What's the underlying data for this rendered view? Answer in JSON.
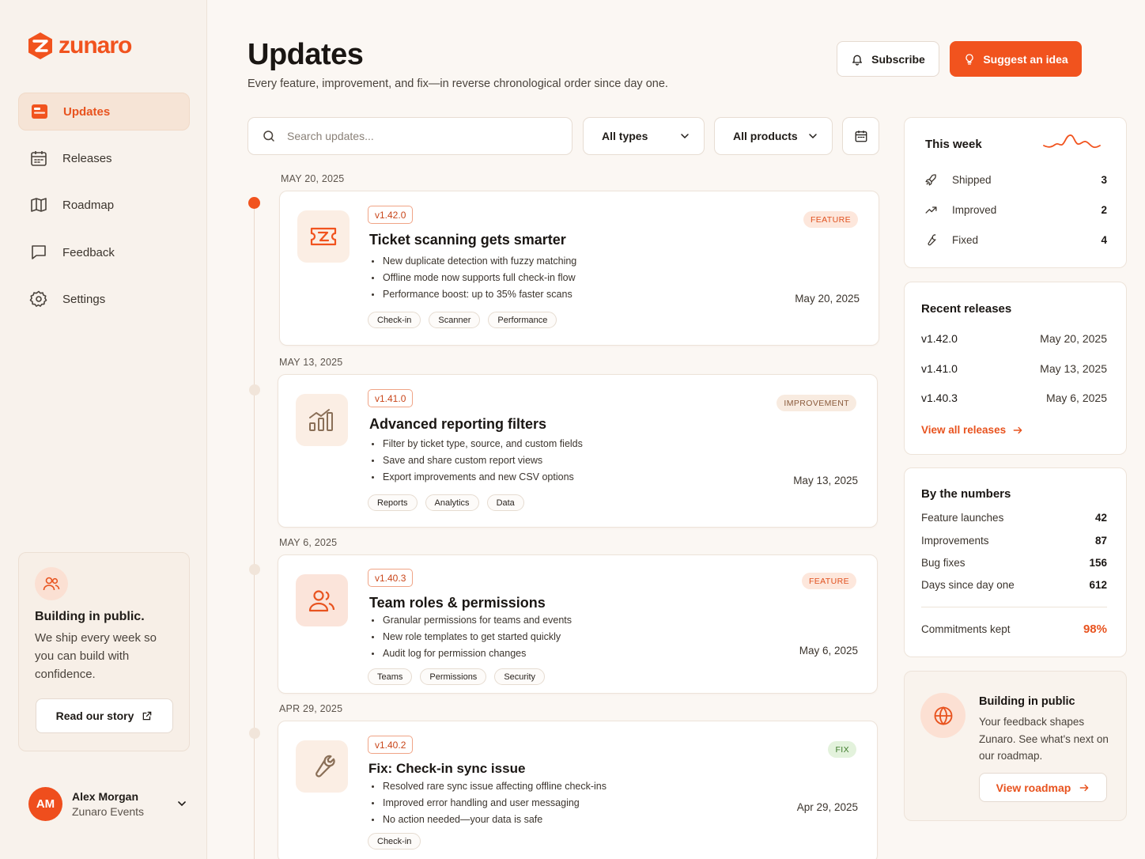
{
  "app": {
    "name": "zunaro"
  },
  "sidebar": {
    "items": [
      {
        "label": "Updates",
        "icon": "updates-icon",
        "active": true
      },
      {
        "label": "Releases",
        "icon": "calendar-icon"
      },
      {
        "label": "Roadmap",
        "icon": "map-icon"
      },
      {
        "label": "Feedback",
        "icon": "chat-bubble-icon"
      },
      {
        "label": "Settings",
        "icon": "gear-icon"
      }
    ],
    "promo": {
      "title": "Building in public.",
      "text": "We ship every week so you can build with confidence.",
      "button": "Read our story"
    },
    "user": {
      "initials": "AM",
      "name": "Alex Morgan",
      "org": "Zunaro Events"
    }
  },
  "header": {
    "title": "Updates",
    "subtitle": "Every feature, improvement, and fix—in reverse chronological order since day one.",
    "subscribe": "Subscribe",
    "suggest": "Suggest an idea"
  },
  "filters": {
    "search_placeholder": "Search updates...",
    "type": "All types",
    "product": "All products"
  },
  "updates": [
    {
      "date_label": "MAY 20, 2025",
      "version": "v1.42.0",
      "title": "Ticket scanning gets smarter",
      "badge": "FEATURE",
      "bullets": [
        "New duplicate detection with fuzzy matching",
        "Offline mode now supports full check-in flow",
        "Performance boost: up to 35% faster scans"
      ],
      "tags": [
        "Check-in",
        "Scanner",
        "Performance"
      ],
      "date": "May 20, 2025"
    },
    {
      "date_label": "MAY 13, 2025",
      "version": "v1.41.0",
      "title": "Advanced reporting filters",
      "badge": "IMPROVEMENT",
      "bullets": [
        "Filter by ticket type, source, and custom fields",
        "Save and share custom report views",
        "Export improvements and new CSV options"
      ],
      "tags": [
        "Reports",
        "Analytics",
        "Data"
      ],
      "date": "May 13, 2025"
    },
    {
      "date_label": "MAY 6, 2025",
      "version": "v1.40.3",
      "title": "Team roles & permissions",
      "badge": "FEATURE",
      "bullets": [
        "Granular permissions for teams and events",
        "New role templates to get started quickly",
        "Audit log for permission changes"
      ],
      "tags": [
        "Teams",
        "Permissions",
        "Security"
      ],
      "date": "May 6, 2025"
    },
    {
      "date_label": "APR 29, 2025",
      "version": "v1.40.2",
      "title": "Fix: Check-in sync issue",
      "badge": "FIX",
      "bullets": [
        "Resolved rare sync issue affecting offline check-ins",
        "Improved error handling and user messaging",
        "No action needed—your data is safe"
      ],
      "tags": [
        "Check-in"
      ],
      "date": "Apr 29, 2025"
    }
  ],
  "this_week": {
    "title": "This week",
    "rows": [
      {
        "label": "Shipped",
        "value": "3"
      },
      {
        "label": "Improved",
        "value": "2"
      },
      {
        "label": "Fixed",
        "value": "4"
      }
    ]
  },
  "recent_releases": {
    "title": "Recent releases",
    "rows": [
      {
        "version": "v1.42.0",
        "date": "May 20, 2025"
      },
      {
        "version": "v1.41.0",
        "date": "May 13, 2025"
      },
      {
        "version": "v1.40.3",
        "date": "May 6, 2025"
      }
    ],
    "link": "View all releases"
  },
  "numbers": {
    "title": "By the numbers",
    "rows": [
      {
        "label": "Feature launches",
        "value": "42"
      },
      {
        "label": "Improvements",
        "value": "87"
      },
      {
        "label": "Bug fixes",
        "value": "156"
      },
      {
        "label": "Days since day one",
        "value": "612"
      }
    ],
    "commit_label": "Commitments kept",
    "commit_value": "98%"
  },
  "public": {
    "title": "Building in public",
    "text": "Your feedback shapes Zunaro. See what's next on our roadmap.",
    "button": "View roadmap"
  },
  "colors": {
    "accent": "#f1531e",
    "feature_bg": "#fde7dc",
    "improvement_bg": "#f8ebe0",
    "fix_bg": "#e3f2dc"
  }
}
